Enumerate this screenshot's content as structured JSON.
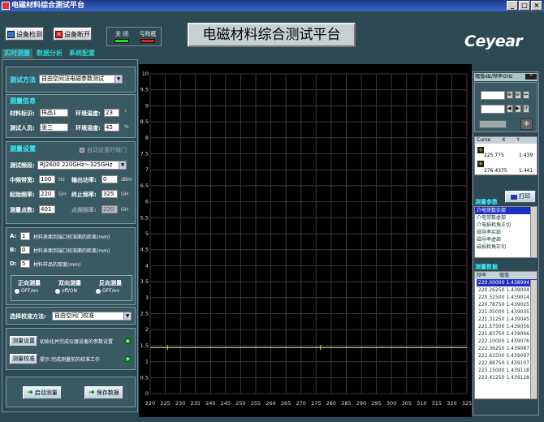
{
  "window": {
    "title": "电磁材料综合测试平台"
  },
  "header": {
    "connect_label": "设备检测",
    "disconnect_label": "设备断开",
    "led1_label": "关 闭",
    "led2_label": "亏阵框",
    "main_title": "电磁材料综合测试平台",
    "logo": "Ceyear"
  },
  "tabs": [
    "实时测量",
    "数据分析",
    "系统配置"
  ],
  "left": {
    "method_label": "测试方法",
    "method_value": "自由空间法电磁参数测试",
    "info_title": "测量信息",
    "material_label": "材料标识:",
    "material_value": "样品1",
    "temp_label": "环境温度:",
    "temp_value": "23",
    "temp_unit": "°",
    "tester_label": "测试人员:",
    "tester_value": "张三",
    "humidity_label": "环境湿度:",
    "humidity_value": "45",
    "humidity_unit": "%",
    "settings_title": "测量设置",
    "auto_gate_label": "自动设置时域门",
    "band_label": "测试频段:",
    "band_value": "RJ2600 220GHz～325GHz",
    "ifbw_label": "中频带宽:",
    "ifbw_value": "100",
    "ifbw_unit": "Hz",
    "power_label": "输出功率:",
    "power_value": "0",
    "power_unit": "dBm",
    "start_label": "起始频率:",
    "start_value": "220",
    "start_unit": "GH",
    "stop_label": "终止频率:",
    "stop_value": "325",
    "stop_unit": "GH",
    "points_label": "测量点数:",
    "points_value": "401",
    "pointfreq_label": "点频频率:",
    "pointfreq_value": "220",
    "pointfreq_unit": "GH",
    "a_label": "A:",
    "a_value": "1",
    "a_desc": "材料表面到端口校准面的距离(mm)",
    "b_label": "B:",
    "b_value": "0",
    "b_desc": "材料表面到端口校准面的距离(mm)",
    "d_label": "D:",
    "d_value": "5",
    "d_desc": "材料样品的厚度(mm)",
    "fwd_label": "正向测量",
    "fwd_opt": "OFF/on",
    "bi_label": "双向测量",
    "bi_opt": "off/ON",
    "rev_label": "反向测量",
    "rev_opt": "OFF/on",
    "cal_method_label": "选择校准方法:",
    "cal_method_value": "自由空间门校准",
    "btn_setup": "测量设置",
    "setup_desc": "初始化并完成仪器设备的参数设置",
    "btn_cal": "测量校准",
    "cal_desc": "提示:完成测量前的校准工作",
    "btn_start": "启动测量",
    "btn_save": "保存数据"
  },
  "chart_data": {
    "type": "line",
    "x": [
      220,
      225,
      230,
      235,
      240,
      245,
      250,
      255,
      260,
      265,
      270,
      275,
      280,
      285,
      290,
      295,
      300,
      305,
      310,
      315,
      320,
      325
    ],
    "series": [
      {
        "values": [
          1.439,
          1.439,
          1.439,
          1.439,
          1.439,
          1.439,
          1.439,
          1.439,
          1.439,
          1.439,
          1.439,
          1.439,
          1.439,
          1.439,
          1.439,
          1.439,
          1.439,
          1.439,
          1.439,
          1.439,
          1.439,
          1.439
        ]
      }
    ],
    "markers": [
      [
        225.775,
        1.439
      ],
      [
        276.4375,
        1.441
      ]
    ],
    "xticks": [
      "220",
      "225",
      "230",
      "235",
      "240",
      "245",
      "250",
      "255",
      "260",
      "265",
      "270",
      "275",
      "280",
      "285",
      "290",
      "295",
      "300",
      "305",
      "310",
      "315",
      "320",
      "325"
    ],
    "yticks": [
      "0",
      "0.5",
      "1",
      "1.5",
      "2",
      "2.5",
      "3",
      "3.5",
      "4",
      "4.5",
      "5",
      "5.5",
      "6",
      "6.5",
      "7",
      "7.5",
      "8",
      "8.5",
      "9",
      "9.5",
      "10"
    ],
    "xlim": [
      220,
      325
    ],
    "ylim": [
      0,
      10
    ],
    "grid": true,
    "colors": {
      "line": "#e8e8a0",
      "grid": "#3a3a3a",
      "marker": "#d0d000"
    }
  },
  "right": {
    "header": "幅值dB/频率GHz",
    "cursor_head_1": "Curse",
    "cursor_head_2": "X",
    "cursor_head_3": "Y",
    "cursor1_x": "225.775",
    "cursor1_y": "1.439",
    "cursor2_x": "276.4375",
    "cursor2_y": "1.441",
    "params_label": "测量参数",
    "print_label": "打印",
    "params": [
      "介电常数实部",
      "介电常数虚部",
      "介电损耗角正切",
      "磁导率实部",
      "磁导率虚部",
      "磁损耗角正切"
    ],
    "data_label": "测量数据",
    "data_head_freq": "频率",
    "data_head_amp": "幅值",
    "data_rows": [
      [
        "220.00000",
        "1.438994"
      ],
      [
        "220.26250",
        "1.439004"
      ],
      [
        "220.52500",
        "1.439014"
      ],
      [
        "220.78750",
        "1.439025"
      ],
      [
        "221.05000",
        "1.439035"
      ],
      [
        "221.31250",
        "1.439045"
      ],
      [
        "221.57500",
        "1.439056"
      ],
      [
        "221.83750",
        "1.439066"
      ],
      [
        "222.10000",
        "1.439076"
      ],
      [
        "222.36250",
        "1.439087"
      ],
      [
        "222.62500",
        "1.439097"
      ],
      [
        "222.88750",
        "1.439107"
      ],
      [
        "223.15000",
        "1.439118"
      ],
      [
        "223.41250",
        "1.439128"
      ]
    ]
  }
}
